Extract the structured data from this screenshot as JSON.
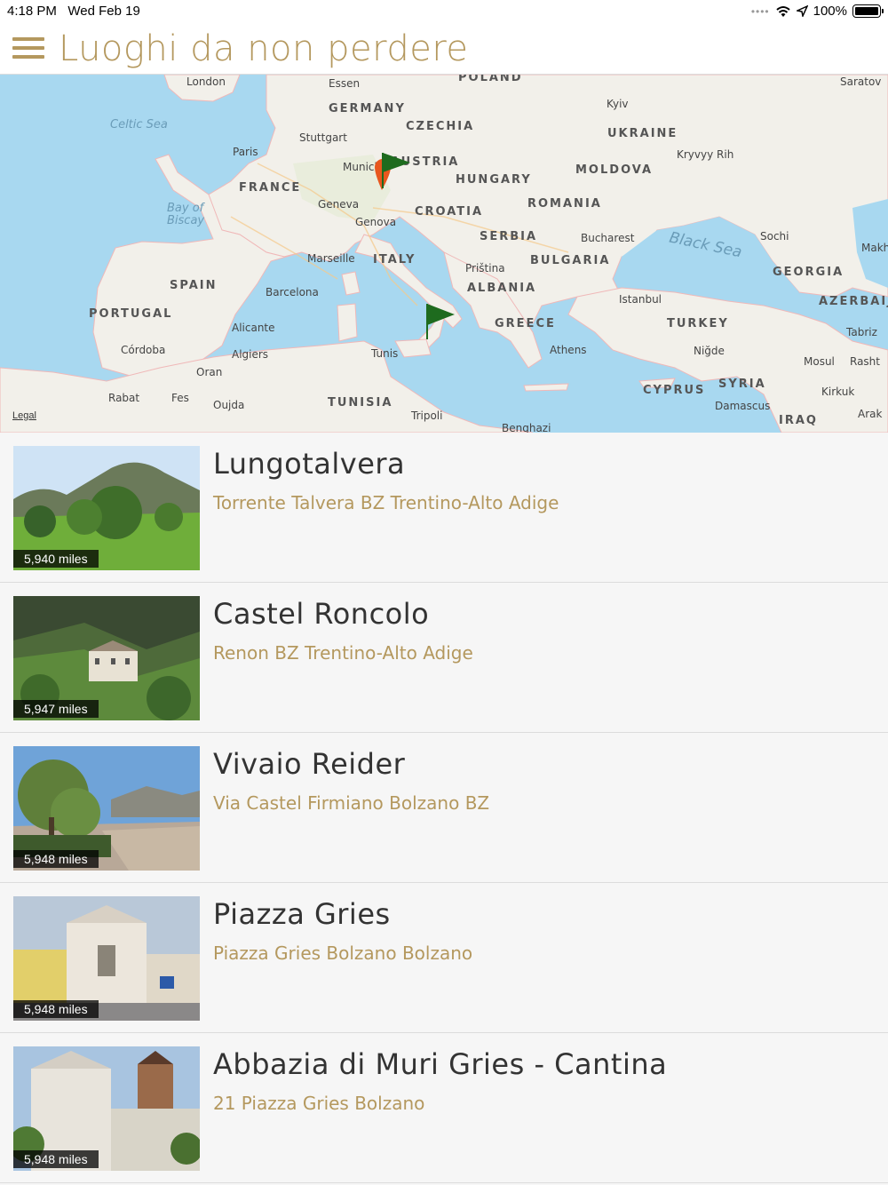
{
  "status": {
    "time": "4:18 PM",
    "date": "Wed Feb 19",
    "battery": "100%"
  },
  "nav": {
    "title": "Luoghi da non perdere"
  },
  "map": {
    "legal": "Legal",
    "countries": [
      "POLAND",
      "GERMANY",
      "CZECHIA",
      "UKRAINE",
      "AUSTRIA",
      "MOLDOVA",
      "HUNGARY",
      "FRANCE",
      "ROMANIA",
      "CROATIA",
      "SERBIA",
      "ITALY",
      "BULGARIA",
      "SPAIN",
      "ALBANIA",
      "PORTUGAL",
      "GREECE",
      "TURKEY",
      "CYPRUS",
      "SYRIA",
      "TUNISIA",
      "IRAQ",
      "GEORGIA",
      "AZERBAIJ"
    ],
    "cities": [
      "London",
      "Essen",
      "Kyiv",
      "Saratov",
      "Stuttgart",
      "Paris",
      "Munich",
      "Kryvyy Rih",
      "Geneva",
      "Genova",
      "Bucharest",
      "Sochi",
      "Makh",
      "Marseille",
      "Priština",
      "Barcelona",
      "Istanbul",
      "Alicante",
      "Tabriz",
      "Córdoba",
      "Algiers",
      "Tunis",
      "Athens",
      "Niğde",
      "Mosul",
      "Rasht",
      "Oran",
      "Kirkuk",
      "Rabat",
      "Fes",
      "Oujda",
      "Damascus",
      "Arak",
      "Tripoli",
      "Benghazi"
    ],
    "seas": [
      "Celtic Sea",
      "Bay of Biscay",
      "Black Sea"
    ]
  },
  "places": [
    {
      "title": "Lungotalvera",
      "subtitle": "Torrente Talvera BZ Trentino-Alto Adige",
      "distance": "5,940 miles"
    },
    {
      "title": "Castel Roncolo",
      "subtitle": "Renon BZ Trentino-Alto Adige",
      "distance": "5,947 miles"
    },
    {
      "title": "Vivaio Reider",
      "subtitle": "Via Castel Firmiano Bolzano BZ",
      "distance": "5,948 miles"
    },
    {
      "title": "Piazza Gries",
      "subtitle": "Piazza Gries Bolzano Bolzano",
      "distance": "5,948 miles"
    },
    {
      "title": "Abbazia di Muri Gries - Cantina",
      "subtitle": "21 Piazza Gries Bolzano",
      "distance": "5,948 miles"
    }
  ],
  "colors": {
    "accent": "#b4985e",
    "map_water": "#a8d8f0",
    "map_land": "#f2f0ea",
    "flag_green": "#1e6b1e",
    "pin_orange": "#e8571e"
  }
}
